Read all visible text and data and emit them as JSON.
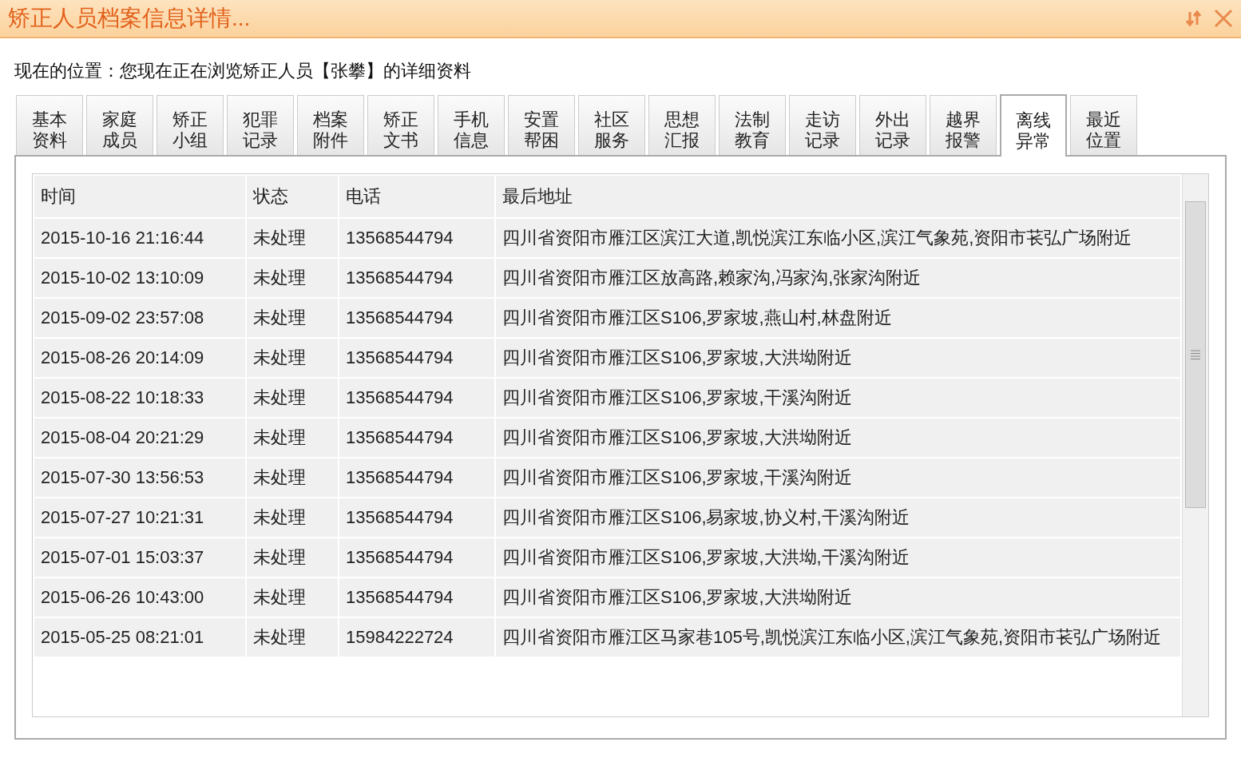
{
  "window": {
    "title": "矫正人员档案信息详情..."
  },
  "location": "现在的位置：您现在正在浏览矫正人员【张攀】的详细资料",
  "tabs": [
    {
      "label": "基本资料",
      "selected": false
    },
    {
      "label": "家庭成员",
      "selected": false
    },
    {
      "label": "矫正小组",
      "selected": false
    },
    {
      "label": "犯罪记录",
      "selected": false
    },
    {
      "label": "档案附件",
      "selected": false
    },
    {
      "label": "矫正文书",
      "selected": false
    },
    {
      "label": "手机信息",
      "selected": false
    },
    {
      "label": "安置帮困",
      "selected": false
    },
    {
      "label": "社区服务",
      "selected": false
    },
    {
      "label": "思想汇报",
      "selected": false
    },
    {
      "label": "法制教育",
      "selected": false
    },
    {
      "label": "走访记录",
      "selected": false
    },
    {
      "label": "外出记录",
      "selected": false
    },
    {
      "label": "越界报警",
      "selected": false
    },
    {
      "label": "离线异常",
      "selected": true
    },
    {
      "label": "最近位置",
      "selected": false
    }
  ],
  "table": {
    "columns": [
      "时间",
      "状态",
      "电话",
      "最后地址"
    ],
    "rows": [
      [
        "2015-10-16 21:16:44",
        "未处理",
        "13568544794",
        "四川省资阳市雁江区滨江大道,凯悦滨江东临小区,滨江气象苑,资阳市苌弘广场附近"
      ],
      [
        "2015-10-02 13:10:09",
        "未处理",
        "13568544794",
        "四川省资阳市雁江区放高路,赖家沟,冯家沟,张家沟附近"
      ],
      [
        "2015-09-02 23:57:08",
        "未处理",
        "13568544794",
        "四川省资阳市雁江区S106,罗家坡,燕山村,林盘附近"
      ],
      [
        "2015-08-26 20:14:09",
        "未处理",
        "13568544794",
        "四川省资阳市雁江区S106,罗家坡,大洪坳附近"
      ],
      [
        "2015-08-22 10:18:33",
        "未处理",
        "13568544794",
        "四川省资阳市雁江区S106,罗家坡,干溪沟附近"
      ],
      [
        "2015-08-04 20:21:29",
        "未处理",
        "13568544794",
        "四川省资阳市雁江区S106,罗家坡,大洪坳附近"
      ],
      [
        "2015-07-30 13:56:53",
        "未处理",
        "13568544794",
        "四川省资阳市雁江区S106,罗家坡,干溪沟附近"
      ],
      [
        "2015-07-27 10:21:31",
        "未处理",
        "13568544794",
        "四川省资阳市雁江区S106,易家坡,协义村,干溪沟附近"
      ],
      [
        "2015-07-01 15:03:37",
        "未处理",
        "13568544794",
        "四川省资阳市雁江区S106,罗家坡,大洪坳,干溪沟附近"
      ],
      [
        "2015-06-26 10:43:00",
        "未处理",
        "13568544794",
        "四川省资阳市雁江区S106,罗家坡,大洪坳附近"
      ],
      [
        "2015-05-25 08:21:01",
        "未处理",
        "15984222724",
        "四川省资阳市雁江区马家巷105号,凯悦滨江东临小区,滨江气象苑,资阳市苌弘广场附近"
      ]
    ]
  }
}
